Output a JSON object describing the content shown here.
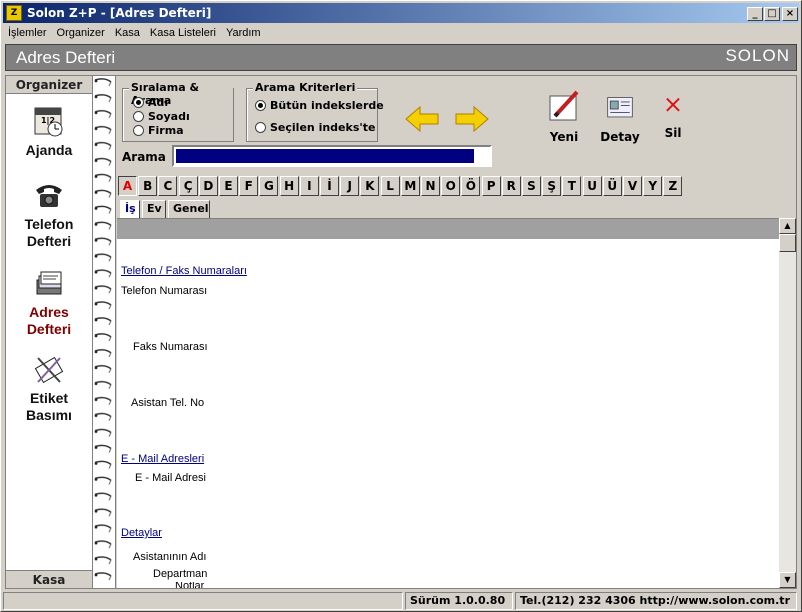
{
  "window": {
    "title": "Solon Z+P - [Adres Defteri]",
    "app_icon": "Z"
  },
  "menu": [
    "İşlemler",
    "Organizer",
    "Kasa",
    "Kasa Listeleri",
    "Yardım"
  ],
  "header": {
    "title": "Adres Defteri",
    "brand": "SOLON"
  },
  "sidebar": {
    "head": "Organizer",
    "foot": "Kasa",
    "items": [
      {
        "label": "Ajanda",
        "icon": "calendar-clock-icon"
      },
      {
        "label": "Telefon Defteri",
        "icon": "telephone-icon"
      },
      {
        "label": "Adres Defteri",
        "icon": "address-book-icon"
      },
      {
        "label": "Etiket Basımı",
        "icon": "label-print-icon"
      }
    ]
  },
  "sort": {
    "legend": "Sıralama & Arama",
    "options": [
      "Adı",
      "Soyadı",
      "Firma"
    ],
    "selected": "Adı"
  },
  "criteria": {
    "legend": "Arama Kriterleri",
    "options": [
      "Bütün indekslerde",
      "Seçilen indeks'te"
    ],
    "selected": "Bütün indekslerde"
  },
  "toolbar": {
    "new_label": "Yeni",
    "detail_label": "Detay",
    "delete_label": "Sil"
  },
  "search": {
    "label": "Arama",
    "value": ""
  },
  "alphabet": [
    "A",
    "B",
    "C",
    "Ç",
    "D",
    "E",
    "F",
    "G",
    "H",
    "I",
    "İ",
    "J",
    "K",
    "L",
    "M",
    "N",
    "O",
    "Ö",
    "P",
    "R",
    "S",
    "Ş",
    "T",
    "U",
    "Ü",
    "V",
    "Y",
    "Z"
  ],
  "alphabet_selected": "A",
  "tabs": [
    "İş",
    "Ev",
    "Genel"
  ],
  "tab_selected": "İş",
  "sections": {
    "phone": "Telefon / Faks Numaraları",
    "mail": "E - Mail Adresleri",
    "details": "Detaylar"
  },
  "fields": {
    "phone": "Telefon Numarası",
    "fax": "Faks Numarası",
    "assistant_phone": "Asistan Tel. No",
    "email": "E - Mail Adresi",
    "assistant_name": "Asistanının Adı",
    "department": "Departman",
    "notes": "Notlar"
  },
  "status": {
    "version": "Sürüm 1.0.0.80",
    "contact": "Tel.(212) 232 4306  http://www.solon.com.tr"
  }
}
